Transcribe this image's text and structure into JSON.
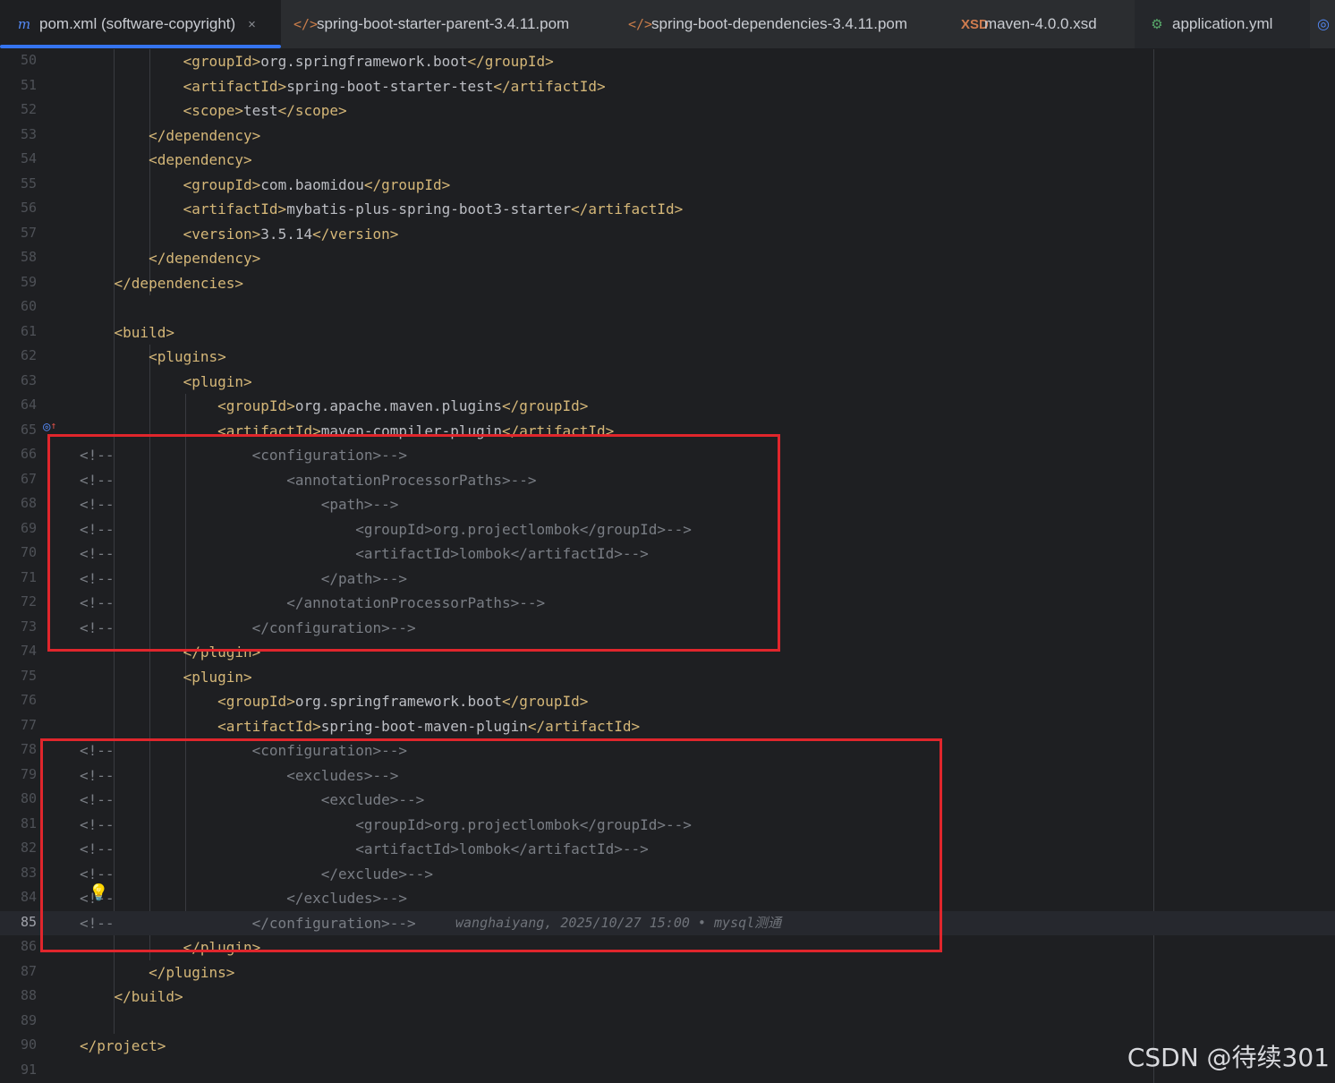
{
  "tabs": [
    {
      "label": "pom.xml (software-copyright)",
      "icon": "maven-m-icon",
      "active": true,
      "closable": true
    },
    {
      "label": "spring-boot-starter-parent-3.4.11.pom",
      "icon": "xml-file-icon"
    },
    {
      "label": "spring-boot-dependencies-3.4.11.pom",
      "icon": "xml-file-icon"
    },
    {
      "label": "maven-4.0.0.xsd",
      "icon": "xsd-file-icon"
    },
    {
      "label": "application.yml",
      "icon": "yml-file-icon"
    }
  ],
  "tab_icon_glyphs": {
    "maven": "m",
    "xml": "</>",
    "xsd": "XSD",
    "yml": "⚙",
    "close": "×"
  },
  "lines": [
    {
      "n": "50",
      "t": "            <groupId>org.springframework.boot</groupId>"
    },
    {
      "n": "51",
      "t": "            <artifactId>spring-boot-starter-test</artifactId>"
    },
    {
      "n": "52",
      "t": "            <scope>test</scope>"
    },
    {
      "n": "53",
      "t": "        </dependency>"
    },
    {
      "n": "54",
      "t": "        <dependency>"
    },
    {
      "n": "55",
      "t": "            <groupId>com.baomidou</groupId>"
    },
    {
      "n": "56",
      "t": "            <artifactId>mybatis-plus-spring-boot3-starter</artifactId>"
    },
    {
      "n": "57",
      "t": "            <version>3.5.14</version>"
    },
    {
      "n": "58",
      "t": "        </dependency>"
    },
    {
      "n": "59",
      "t": "    </dependencies>"
    },
    {
      "n": "60",
      "t": ""
    },
    {
      "n": "61",
      "t": "    <build>"
    },
    {
      "n": "62",
      "t": "        <plugins>"
    },
    {
      "n": "63",
      "t": "            <plugin>"
    },
    {
      "n": "64",
      "t": "                <groupId>org.apache.maven.plugins</groupId>"
    },
    {
      "n": "65",
      "t": "                <artifactId>maven-compiler-plugin</artifactId>"
    },
    {
      "n": "66",
      "t": "<!--                <configuration>-->"
    },
    {
      "n": "67",
      "t": "<!--                    <annotationProcessorPaths>-->"
    },
    {
      "n": "68",
      "t": "<!--                        <path>-->"
    },
    {
      "n": "69",
      "t": "<!--                            <groupId>org.projectlombok</groupId>-->"
    },
    {
      "n": "70",
      "t": "<!--                            <artifactId>lombok</artifactId>-->"
    },
    {
      "n": "71",
      "t": "<!--                        </path>-->"
    },
    {
      "n": "72",
      "t": "<!--                    </annotationProcessorPaths>-->"
    },
    {
      "n": "73",
      "t": "<!--                </configuration>-->"
    },
    {
      "n": "74",
      "t": "            </plugin>"
    },
    {
      "n": "75",
      "t": "            <plugin>"
    },
    {
      "n": "76",
      "t": "                <groupId>org.springframework.boot</groupId>"
    },
    {
      "n": "77",
      "t": "                <artifactId>spring-boot-maven-plugin</artifactId>"
    },
    {
      "n": "78",
      "t": "<!--                <configuration>-->"
    },
    {
      "n": "79",
      "t": "<!--                    <excludes>-->"
    },
    {
      "n": "80",
      "t": "<!--                        <exclude>-->"
    },
    {
      "n": "81",
      "t": "<!--                            <groupId>org.projectlombok</groupId>-->"
    },
    {
      "n": "82",
      "t": "<!--                            <artifactId>lombok</artifactId>-->"
    },
    {
      "n": "83",
      "t": "<!--                        </exclude>-->"
    },
    {
      "n": "84",
      "t": "<!--                    </excludes>-->"
    },
    {
      "n": "85",
      "t": "<!--                </configuration>-->",
      "current": true,
      "blame": "wanghaiyang, 2025/10/27 15:00 • mysql测通"
    },
    {
      "n": "86",
      "t": "            </plugin>"
    },
    {
      "n": "87",
      "t": "        </plugins>"
    },
    {
      "n": "88",
      "t": "    </build>"
    },
    {
      "n": "89",
      "t": ""
    },
    {
      "n": "90",
      "t": "</project>"
    },
    {
      "n": "91",
      "t": ""
    }
  ],
  "watermark": "CSDN @待续301",
  "colors": {
    "tag": "#d5b778",
    "text": "#bcbec4",
    "comment": "#7a7e85",
    "highlight_box": "#e0262c",
    "tab_underline": "#3574f0"
  }
}
